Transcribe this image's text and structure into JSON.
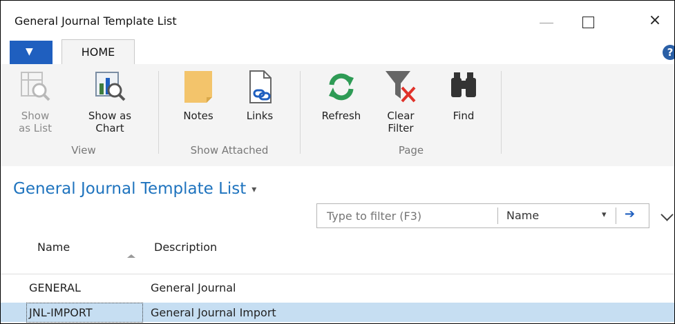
{
  "window": {
    "title": "General Journal Template List"
  },
  "ribbon": {
    "tab_home": "HOME",
    "help_glyph": "?",
    "buttons": {
      "show_as_list": {
        "line1": "Show",
        "line2": "as List",
        "icon": "list-view-icon",
        "disabled": true
      },
      "show_as_chart": {
        "line1": "Show as",
        "line2": "Chart",
        "icon": "chart-view-icon"
      },
      "notes": {
        "line1": "Notes",
        "icon": "notes-icon"
      },
      "links": {
        "line1": "Links",
        "icon": "links-icon"
      },
      "refresh": {
        "line1": "Refresh",
        "icon": "refresh-icon"
      },
      "clear_filter": {
        "line1": "Clear",
        "line2": "Filter",
        "icon": "clear-filter-icon"
      },
      "find": {
        "line1": "Find",
        "icon": "binoculars-icon"
      }
    },
    "groups": {
      "view": "View",
      "show_attached": "Show Attached",
      "page": "Page"
    }
  },
  "page": {
    "title": "General Journal Template List",
    "title_caret": "▾"
  },
  "filter": {
    "placeholder": "Type to filter (F3)",
    "field": "Name",
    "field_caret": "▾",
    "go_glyph": "➔"
  },
  "table": {
    "columns": [
      "Name",
      "Description"
    ],
    "rows": [
      {
        "name": "GENERAL",
        "description": "General Journal",
        "selected": false
      },
      {
        "name": "JNL-IMPORT",
        "description": "General Journal Import",
        "selected": true
      }
    ]
  },
  "colors": {
    "accent": "#1e73be",
    "app_menu": "#1f5fbf",
    "selected_row": "#c6def2",
    "ribbon_bg": "#f4f4f4"
  }
}
